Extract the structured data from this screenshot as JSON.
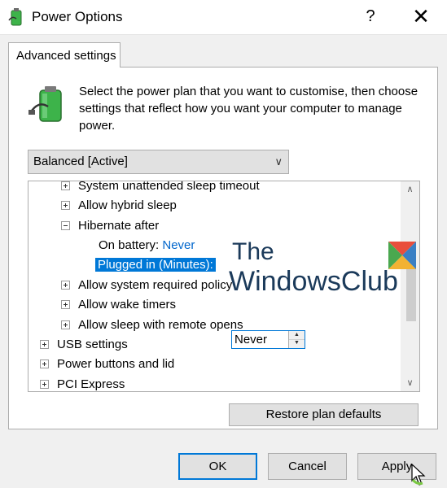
{
  "window": {
    "title": "Power Options",
    "help_glyph": "?",
    "close_glyph": "✕"
  },
  "tab": {
    "label": "Advanced settings"
  },
  "description": "Select the power plan that you want to customise, then choose settings that reflect how you want your computer to manage power.",
  "plan_select": {
    "value": "Balanced [Active]"
  },
  "tree": {
    "partial_top": "System unattended sleep timeout",
    "hybrid": "Allow hybrid sleep",
    "hibernate": "Hibernate after",
    "on_battery_label": "On battery:",
    "on_battery_value": "Never",
    "plugged_label": "Plugged in (Minutes):",
    "plugged_value": "Never",
    "required_policy": "Allow system required policy",
    "wake_timers": "Allow wake timers",
    "sleep_remote": "Allow sleep with remote opens",
    "usb": "USB settings",
    "power_buttons": "Power buttons and lid",
    "pci": "PCI Express"
  },
  "buttons": {
    "restore": "Restore plan defaults",
    "ok": "OK",
    "cancel": "Cancel",
    "apply": "Apply"
  },
  "watermark": {
    "the": "The",
    "windowsclub": "WindowsClub"
  },
  "colors": {
    "accent": "#0078d7",
    "link": "#0066cc",
    "battery_green": "#3db34a"
  },
  "icons": {
    "app": "power-options-battery-icon",
    "chevron": "chevron-down-icon",
    "scroll_up": "chevron-up-icon",
    "scroll_down": "chevron-down-icon"
  }
}
